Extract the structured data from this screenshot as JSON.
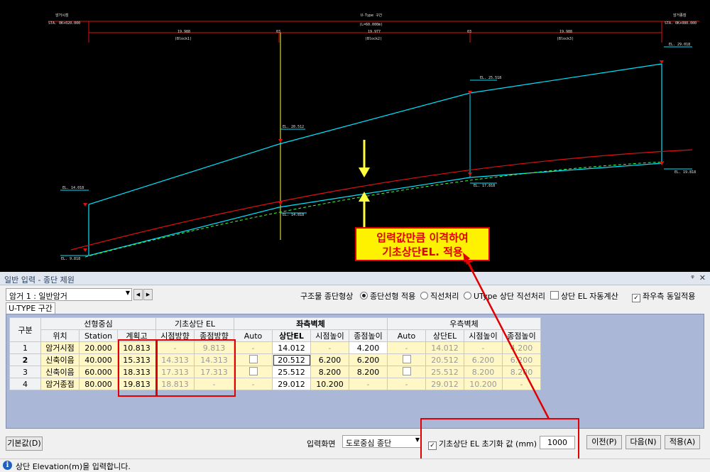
{
  "drawing": {
    "start_title": "암거시점",
    "start_sta": "STA. 0K+020.000",
    "center_title": "U-Type 구간",
    "center_len": "(L=60.000m)",
    "end_title": "암거종점",
    "end_sta": "STA. 0K+080.000",
    "blocks": [
      {
        "len": "19.988",
        "name": "(Block1)"
      },
      {
        "len": "19.977",
        "name": "(Block2)"
      },
      {
        "len": "19.988",
        "name": "(Block3)"
      }
    ],
    "joint_1": "03",
    "joint_2": "03",
    "el_labels": {
      "a": "EL. 29.018",
      "b": "EL. 25.518",
      "c": "EL. 20.512",
      "d": "EL. 14.018",
      "e": "EL. 14.818",
      "f": "EL. 17.818",
      "g": "EL. 19.818",
      "h": "EL. 9.818"
    },
    "callout_line1": "입력값만큼 이격하여",
    "callout_line2": "기초상단EL. 적용"
  },
  "panel": {
    "title": "일반 입력 - 종단 제원",
    "pin": "ᵠ",
    "close": "✕",
    "culvert_select": "암거 1 : 일반암거",
    "shape_label": "구조물 종단형상",
    "radio_profile": "종단선형 적용",
    "radio_straight": "직선처리",
    "radio_utype": "UType 상단 직선처리",
    "chk_auto_el": "상단 EL 자동계산",
    "chk_same": "좌우측 동일적용",
    "tab": "U-TYPE 구간"
  },
  "table": {
    "h_gubun": "구분",
    "h_center": "선형중심",
    "h_base": "기초상단 EL",
    "h_left": "좌측벽체",
    "h_right": "우측벽체",
    "h_pos": "위치",
    "h_station": "Station",
    "h_plan": "계획고",
    "h_start_dir": "시점방향",
    "h_end_dir": "종점방향",
    "h_auto": "Auto",
    "h_top_el": "상단EL",
    "h_start_h": "시점높이",
    "h_end_h": "종점높이",
    "h_auto2": "Auto",
    "h_top_el2": "상단EL",
    "h_start_h2": "시점높이",
    "h_end_h2": "종점높이",
    "rows": [
      {
        "no": "1",
        "pos": "암거시점",
        "station": "20.000",
        "plan": "10.813",
        "bs": "-",
        "be": "9.813",
        "l_top": "14.012",
        "l_sh": "-",
        "l_eh": "4.200",
        "r_top": "14.012",
        "r_sh": "-",
        "r_eh": "4.200"
      },
      {
        "no": "2",
        "pos": "신축이음",
        "station": "40.000",
        "plan": "15.313",
        "bs": "14.313",
        "be": "14.313",
        "l_top": "20.512",
        "l_sh": "6.200",
        "l_eh": "6.200",
        "r_top": "20.512",
        "r_sh": "6.200",
        "r_eh": "6.200"
      },
      {
        "no": "3",
        "pos": "신축이음",
        "station": "60.000",
        "plan": "18.313",
        "bs": "17.313",
        "be": "17.313",
        "l_top": "25.512",
        "l_sh": "8.200",
        "l_eh": "8.200",
        "r_top": "25.512",
        "r_sh": "8.200",
        "r_eh": "8.200"
      },
      {
        "no": "4",
        "pos": "암거종점",
        "station": "80.000",
        "plan": "19.813",
        "bs": "18.813",
        "be": "-",
        "l_top": "29.012",
        "l_sh": "10.200",
        "l_eh": "-",
        "r_top": "29.012",
        "r_sh": "10.200",
        "r_eh": "-"
      }
    ]
  },
  "footer": {
    "default_btn": "기본값(D)",
    "input_screen_label": "입력화면",
    "input_screen_value": "도로중심 종단",
    "init_chk": "기초상단 EL 초기화 값 (mm)",
    "init_value": "1000",
    "prev_btn": "이전(P)",
    "next_btn": "다음(N)",
    "apply_btn": "적용(A)"
  },
  "status": {
    "message": "상단 Elevation(m)을 입력합니다."
  },
  "colors": {
    "cad_bg": "#000000",
    "cyan": "#00e5ff",
    "red": "#e01010",
    "green": "#3cff3c",
    "yellow": "#ffff40",
    "callout_fill": "#fff200",
    "highlight": "#e00000"
  }
}
